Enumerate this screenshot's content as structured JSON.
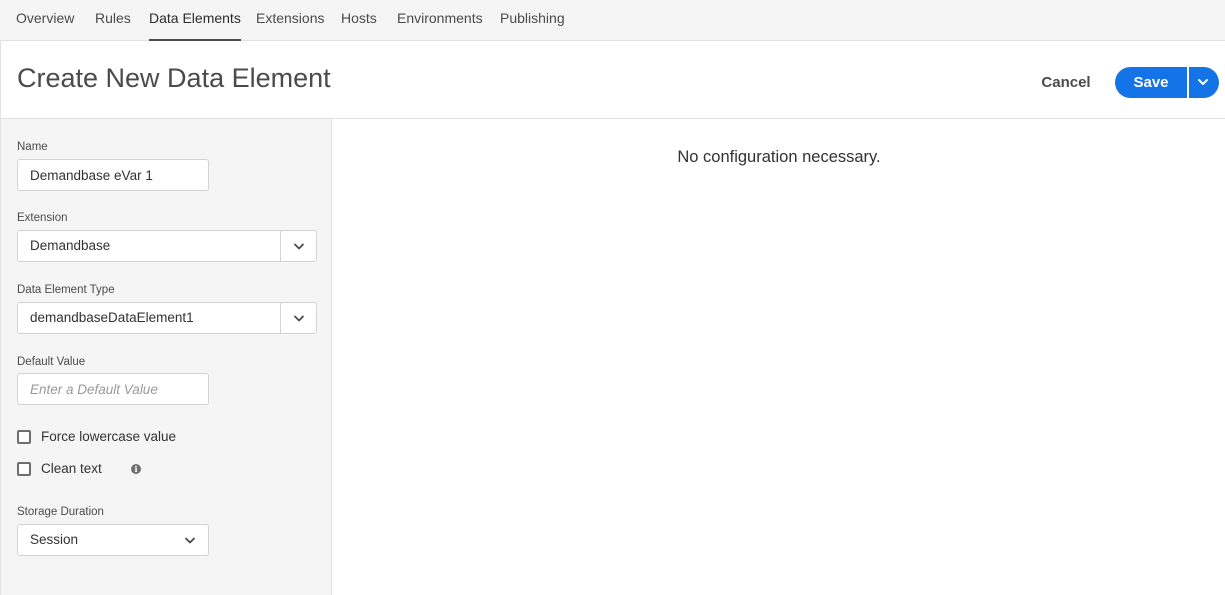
{
  "nav": {
    "tabs": [
      {
        "label": "Overview",
        "active": false
      },
      {
        "label": "Rules",
        "active": false
      },
      {
        "label": "Data Elements",
        "active": true
      },
      {
        "label": "Extensions",
        "active": false
      },
      {
        "label": "Hosts",
        "active": false
      },
      {
        "label": "Environments",
        "active": false
      },
      {
        "label": "Publishing",
        "active": false
      }
    ]
  },
  "header": {
    "title": "Create New Data Element",
    "cancel_label": "Cancel",
    "save_label": "Save",
    "save_menu_icon": "chevron-down-icon",
    "accent_color": "#1473e6"
  },
  "form": {
    "name": {
      "label": "Name",
      "value": "Demandbase eVar 1"
    },
    "extension": {
      "label": "Extension",
      "value": "Demandbase",
      "icon": "chevron-down-icon"
    },
    "data_element_type": {
      "label": "Data Element Type",
      "value": "demandbaseDataElement1",
      "icon": "chevron-down-icon"
    },
    "default_value": {
      "label": "Default Value",
      "value": "",
      "placeholder": "Enter a Default Value"
    },
    "force_lowercase": {
      "label": "Force lowercase value",
      "checked": false
    },
    "clean_text": {
      "label": "Clean text",
      "checked": false,
      "icon": "info-icon"
    },
    "storage_duration": {
      "label": "Storage Duration",
      "value": "Session",
      "icon": "chevron-down-icon"
    }
  },
  "main": {
    "message": "No configuration necessary."
  }
}
